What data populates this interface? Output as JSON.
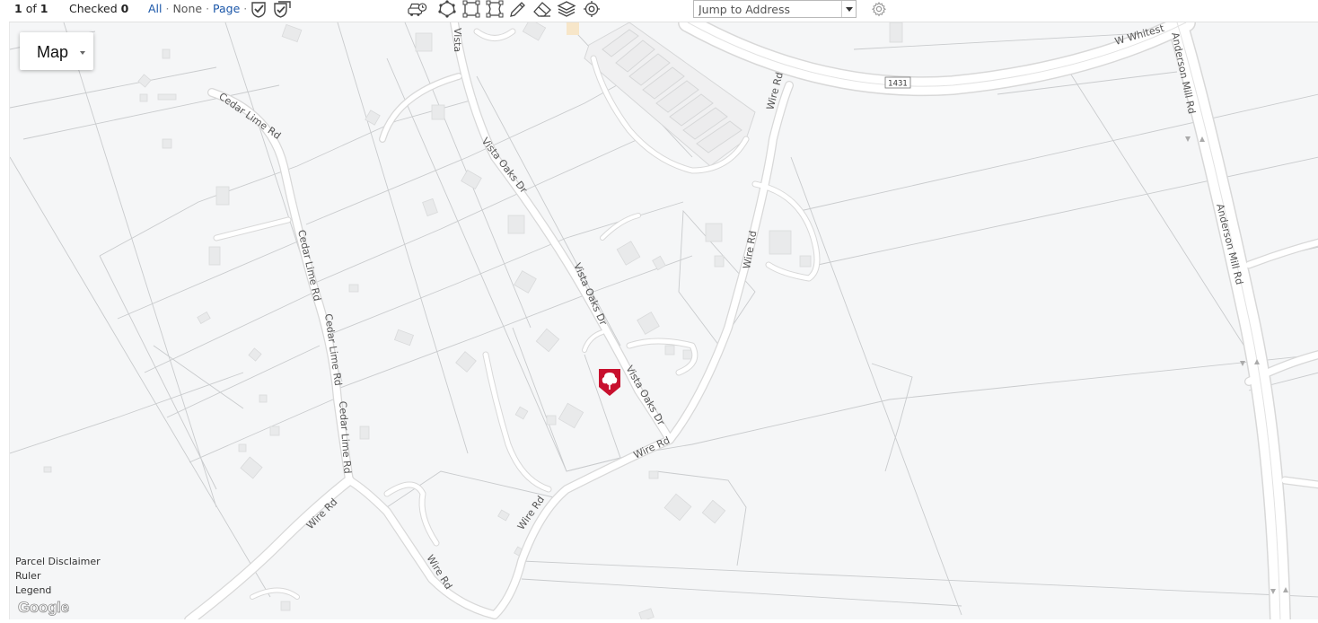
{
  "toolbar": {
    "count_current": "1",
    "count_of": "of",
    "count_total": "1",
    "checked_label": "Checked",
    "checked_value": "0",
    "select_all": "All",
    "select_none": "None",
    "select_page": "Page",
    "dot": "·",
    "icons": [
      "check-icon",
      "double-check-icon",
      "calendar-car-icon",
      "polygon-select-icon",
      "rectangle-select-icon",
      "rectangle-edit-icon",
      "pencil-icon",
      "eraser-icon",
      "layers-icon",
      "locate-icon"
    ]
  },
  "jump": {
    "placeholder": "Jump to Address",
    "dropdown_icon": "caret-down-icon",
    "settings_icon": "gear-icon"
  },
  "map": {
    "maptype_label": "Map",
    "roads": {
      "cedar_lime_1": "Cedar Lime Rd",
      "cedar_lime_2": "Cedar Lime Rd",
      "cedar_lime_3": "Cedar Lime Rd",
      "cedar_lime_4": "Cedar Lime Rd",
      "cedar_lime_5": "Cedar Lime Rd",
      "vista_top": "Vista",
      "vista_oaks_1": "Vista Oaks Dr",
      "vista_oaks_2": "Vista Oaks Dr",
      "vista_oaks_3": "Vista Oaks Dr",
      "wire_1": "Wire Rd",
      "wire_2": "Wire Rd",
      "wire_3": "Wire Rd",
      "wire_4": "Wire Rd",
      "wire_5": "Wire Rd",
      "wire_6": "Wire Rd",
      "w_whitestone": "W Whitest",
      "anderson_1": "Anderson Mill Rd",
      "anderson_2": "Anderson Mill Rd",
      "route_badge": "1431"
    },
    "marker_icon": "tree-marker-icon",
    "links": {
      "parcel_disclaimer": "Parcel Disclaimer",
      "ruler": "Ruler",
      "legend": "Legend"
    },
    "attribution": "Google",
    "colors": {
      "background": "#f5f6f7",
      "road": "#ffffff",
      "road_edge": "#d8d8d8",
      "parcel_line": "#c9cbcd",
      "building": "#e9eaeb",
      "marker": "#c8102e",
      "link": "#1a56a8"
    }
  }
}
